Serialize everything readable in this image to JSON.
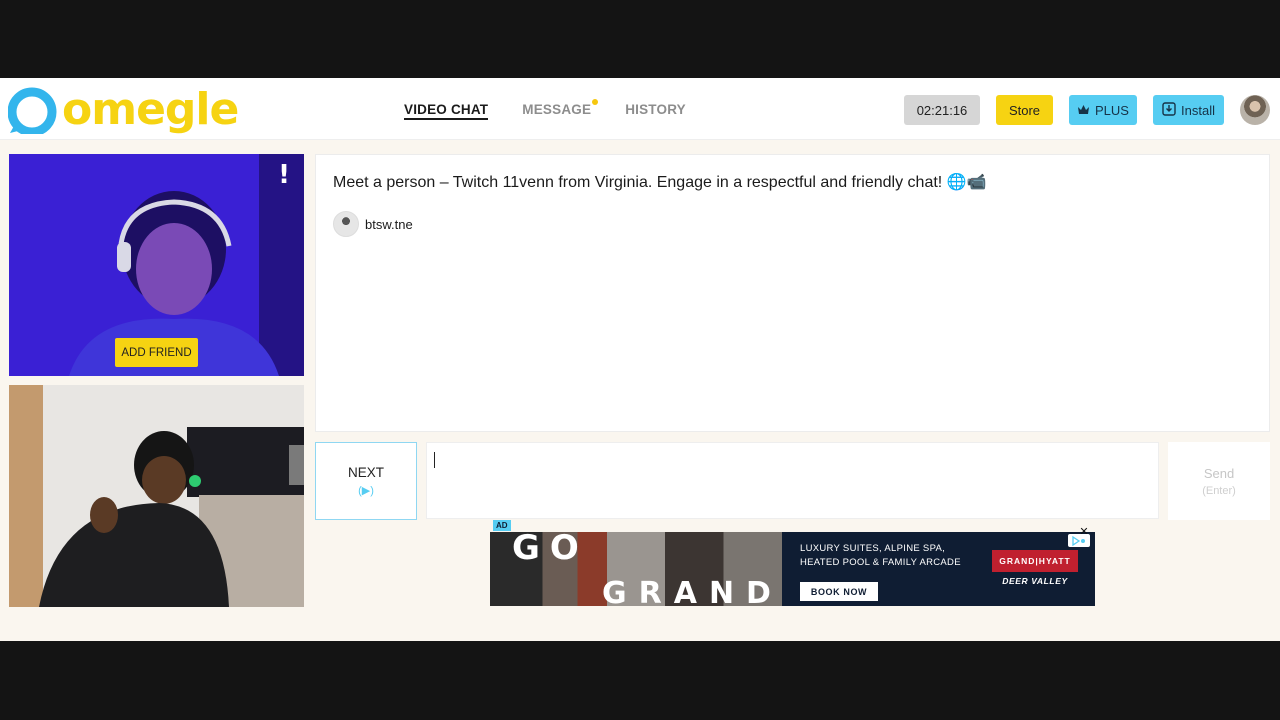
{
  "header": {
    "logo_text": "omegle",
    "nav": [
      {
        "label": "VIDEO CHAT",
        "active": true
      },
      {
        "label": "MESSAGE",
        "active": false,
        "has_notification": true
      },
      {
        "label": "HISTORY",
        "active": false
      }
    ],
    "timer": "02:21:16",
    "store_label": "Store",
    "plus_label": "PLUS",
    "install_label": "Install"
  },
  "video": {
    "report_label": "!",
    "add_friend_label": "ADD FRIEND"
  },
  "chat": {
    "intro": "Meet a person – Twitch 11venn from Virginia. Engage in a respectful and friendly chat! 🌐📹",
    "partner_name": "btsw.tne"
  },
  "controls": {
    "next_label": "NEXT",
    "next_hint": "(▶)",
    "input_value": "",
    "send_label": "Send",
    "send_hint": "(Enter)"
  },
  "ad": {
    "tag": "AD",
    "headline_1": "GO",
    "headline_2": "GRAND",
    "copy": "LUXURY SUITES, ALPINE SPA, HEATED POOL & FAMILY ARCADE",
    "cta": "BOOK NOW",
    "brand": "GRAND|HYATT",
    "location": "DEER VALLEY",
    "close": "✕"
  },
  "colors": {
    "brand_yellow": "#f6d312",
    "accent_blue": "#56cdf2",
    "logo_blue": "#33b5ec",
    "remote_video_tint": "#3b1fd6",
    "ad_background": "#0f1d33"
  }
}
